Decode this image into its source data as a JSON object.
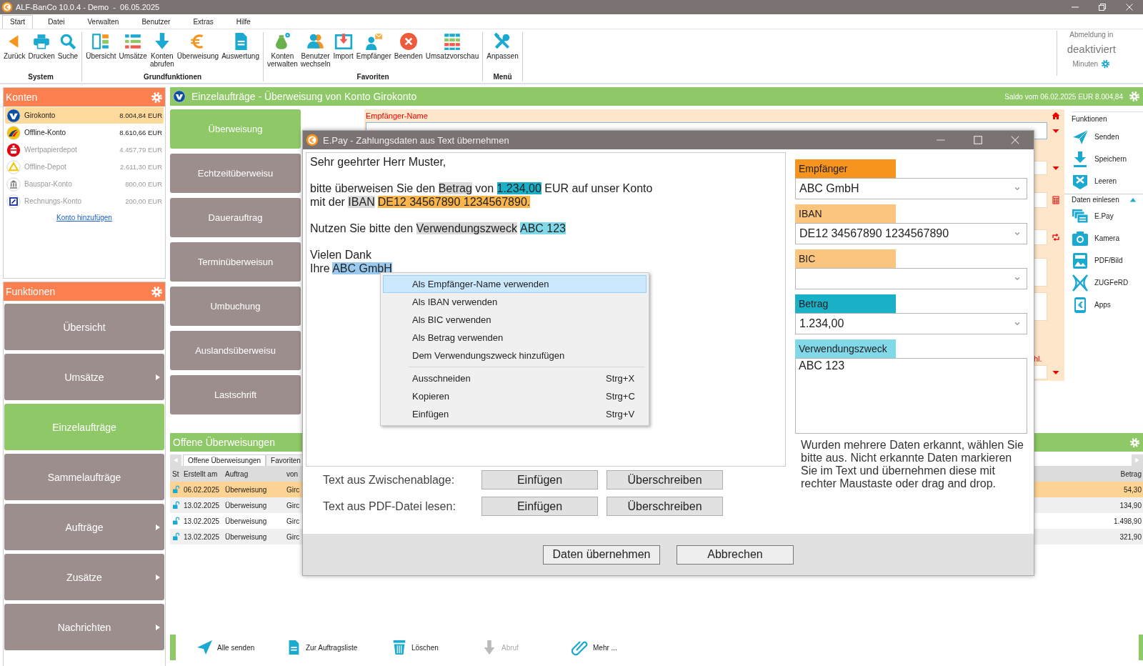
{
  "window": {
    "title": "ALF-BanCo 10.0.4 - Demo  -  06.05.2025"
  },
  "menu_tabs": [
    {
      "label": "Start",
      "selected": true
    },
    {
      "label": "Datei",
      "selected": false
    },
    {
      "label": "Verwalten",
      "selected": false
    },
    {
      "label": "Benutzer",
      "selected": false
    },
    {
      "label": "Extras",
      "selected": false
    },
    {
      "label": "Hilfe",
      "selected": false
    }
  ],
  "ribbon": {
    "groups": [
      {
        "label": "System",
        "buttons": [
          "Zurück",
          "Drucken",
          "Suche"
        ]
      },
      {
        "label": "Grundfunktionen",
        "buttons": [
          "Übersicht",
          "Umsätze",
          "Konten abrufen",
          "Überweisung",
          "Auswertung"
        ]
      },
      {
        "label": "Favoriten",
        "buttons": [
          "Konten verwalten",
          "Benutzer wechseln",
          "Import",
          "Empfänger",
          "Beenden",
          "Umsatzvorschau"
        ]
      },
      {
        "label": "Menü",
        "buttons": [
          "Anpassen"
        ]
      }
    ],
    "session": {
      "caption": "Abmeldung in",
      "value": "deaktiviert",
      "unit": "Minuten"
    }
  },
  "accounts_panel": {
    "title": "Konten",
    "accounts": [
      {
        "name": "Girokonto",
        "balance": "8.004,84 EUR",
        "selected": true,
        "disabled": false
      },
      {
        "name": "Offline-Konto",
        "balance": "8.610,66 EUR",
        "selected": false,
        "disabled": false
      },
      {
        "name": "Wertpapierdepot",
        "balance": "4.457,79 EUR",
        "selected": false,
        "disabled": true
      },
      {
        "name": "Offline-Depot",
        "balance": "2.611,30 EUR",
        "selected": false,
        "disabled": true
      },
      {
        "name": "Bauspar-Konto",
        "balance": "800,00 EUR",
        "selected": false,
        "disabled": true
      },
      {
        "name": "Rechnungs-Konto",
        "balance": "200,00 EUR",
        "selected": false,
        "disabled": true
      }
    ],
    "add_link": "Konto hinzufügen"
  },
  "functions_panel": {
    "title": "Funktionen",
    "items": [
      {
        "label": "Übersicht",
        "selected": false,
        "has_submenu": false
      },
      {
        "label": "Umsätze",
        "selected": false,
        "has_submenu": true
      },
      {
        "label": "Einzelaufträge",
        "selected": true,
        "has_submenu": false
      },
      {
        "label": "Sammelaufträge",
        "selected": false,
        "has_submenu": false
      },
      {
        "label": "Aufträge",
        "selected": false,
        "has_submenu": true
      },
      {
        "label": "Zusätze",
        "selected": false,
        "has_submenu": true
      },
      {
        "label": "Nachrichten",
        "selected": false,
        "has_submenu": true
      }
    ]
  },
  "header": {
    "title": "Einzelaufträge - Überweisung von Konto Girokonto",
    "balance": "Saldo vom 06.02.2025 EUR 8.004,84"
  },
  "order_types": [
    {
      "label": "Überweisung",
      "selected": true
    },
    {
      "label": "Echtzeitüberweisu",
      "selected": false
    },
    {
      "label": "Dauerauftrag",
      "selected": false
    },
    {
      "label": "Terminüberweisun",
      "selected": false
    },
    {
      "label": "Umbuchung",
      "selected": false
    },
    {
      "label": "Auslandsüberweisu",
      "selected": false
    },
    {
      "label": "Lastschrift",
      "selected": false
    }
  ],
  "form": {
    "recipient_label": "Empfänger-Name",
    "cut_label": "hl."
  },
  "side_functions": {
    "title": "Funktionen",
    "items": [
      "Senden",
      "Speichern",
      "Leeren"
    ],
    "import_title": "Daten einlesen",
    "import_expanded": true,
    "import_items": [
      "E.Pay",
      "Kamera",
      "PDF/Bild",
      "ZUGFeRD",
      "Apps"
    ]
  },
  "open_transfers": {
    "title": "Offene Überweisungen",
    "tabs": [
      {
        "label": "Offene Überweisungen",
        "selected": true
      },
      {
        "label": "Favoriten",
        "selected": false
      }
    ],
    "columns": [
      "St",
      "Erstellt am",
      "Auftrag",
      "von",
      "Betrag"
    ],
    "rows": [
      {
        "date": "06.02.2025",
        "order": "Überweisung",
        "from": "Girc",
        "amount": "54,30",
        "selected": true
      },
      {
        "date": "13.02.2025",
        "order": "Überweisung",
        "from": "Girc",
        "amount": "134,90",
        "selected": false
      },
      {
        "date": "13.02.2025",
        "order": "Überweisung",
        "from": "Girc",
        "amount": "1.498,90",
        "selected": false
      },
      {
        "date": "13.02.2025",
        "order": "Überweisung",
        "from": "Girc",
        "amount": "321,90",
        "selected": false
      }
    ]
  },
  "bottom_toolbar": [
    {
      "label": "Alle senden",
      "disabled": false
    },
    {
      "label": "Zur Auftragsliste",
      "disabled": false
    },
    {
      "label": "Löschen",
      "disabled": false
    },
    {
      "label": "Abruf",
      "disabled": true
    },
    {
      "label": "Mehr ...",
      "disabled": false
    }
  ],
  "dialog": {
    "title": "E.Pay - Zahlungsdaten aus Text übernehmen",
    "letter": [
      [
        [
          {
            "text": "Sehr geehrter Herr Muster,",
            "kind": "plain"
          }
        ]
      ],
      [
        [
          {
            "text": "bitte überweisen Sie den ",
            "kind": "plain"
          },
          {
            "text": "Betrag",
            "kind": "label"
          },
          {
            "text": " von ",
            "kind": "plain"
          },
          {
            "text": "1.234,00",
            "kind": "amount"
          },
          {
            "text": " EUR auf unser Konto",
            "kind": "plain"
          }
        ],
        [
          {
            "text": "mit der ",
            "kind": "plain"
          },
          {
            "text": "IBAN",
            "kind": "label"
          },
          {
            "text": "DE12 34567890 1234567890.",
            "kind": "iban"
          }
        ]
      ],
      [
        [
          {
            "text": "Nutzen Sie bitte den ",
            "kind": "plain"
          },
          {
            "text": "Verwendungszweck",
            "kind": "label"
          },
          {
            "text": "ABC 123",
            "kind": "purpose"
          }
        ]
      ],
      [
        [
          {
            "text": "Vielen Dank",
            "kind": "plain"
          }
        ],
        [
          {
            "text": "Ihre ",
            "kind": "plain"
          },
          {
            "text": "ABC GmbH",
            "kind": "selection"
          }
        ]
      ]
    ],
    "fields": [
      {
        "label": "Empfänger",
        "color": "#f7941d",
        "kind": "select",
        "value": "ABC GmbH"
      },
      {
        "label": "IBAN",
        "color": "#fcc57f",
        "kind": "select",
        "value": "DE12 34567890 1234567890"
      },
      {
        "label": "BIC",
        "color": "#fcc57f",
        "kind": "select"
      },
      {
        "label": "Betrag",
        "color": "#1ab0c8",
        "kind": "select",
        "value": "1.234,00"
      },
      {
        "label": "Verwendungszweck",
        "color": "#80d8e8",
        "kind": "textarea",
        "value": "ABC 123"
      }
    ],
    "hint": "Wurden mehrere Daten erkannt, wählen Sie bitte aus. Nicht erkannte Daten markieren Sie im Text und übernehmen diese mit rechter Maustaste oder drag and drop.",
    "sources": [
      {
        "label": "Text aus Zwischenablage:",
        "buttons": [
          "Einfügen",
          "Überschreiben"
        ]
      },
      {
        "label": "Text aus PDF-Datei lesen:",
        "buttons": [
          "Einfügen",
          "Überschreiben"
        ]
      }
    ],
    "buttons": [
      "Daten übernehmen",
      "Abbrechen"
    ],
    "context_menu": {
      "sections": [
        [
          {
            "label": "Als Empfänger-Name verwenden",
            "selected": true
          },
          {
            "label": "Als IBAN verwenden",
            "selected": false
          },
          {
            "label": "Als BIC verwenden",
            "selected": false
          },
          {
            "label": "Als Betrag verwenden",
            "selected": false
          },
          {
            "label": "Dem Verwendungszweck hinzufügen",
            "selected": false
          }
        ],
        [
          {
            "label": "Ausschneiden",
            "shortcut": "Strg+X",
            "selected": false
          },
          {
            "label": "Kopieren",
            "shortcut": "Strg+C",
            "selected": false
          },
          {
            "label": "Einfügen",
            "shortcut": "Strg+V",
            "selected": false
          }
        ]
      ]
    }
  }
}
